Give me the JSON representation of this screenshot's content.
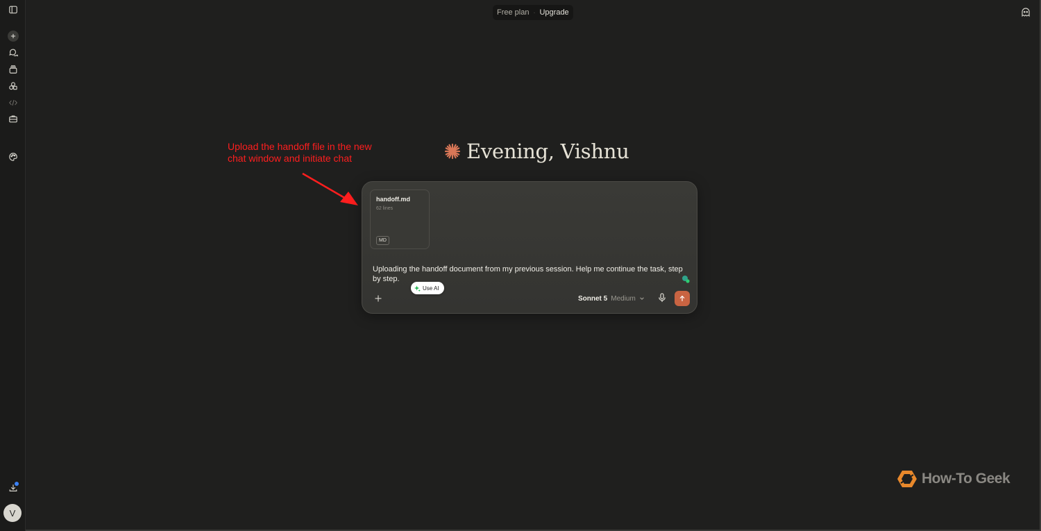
{
  "topbar": {
    "plan_label": "Free plan",
    "separator": "·",
    "upgrade_label": "Upgrade"
  },
  "greeting": {
    "text": "Evening, Vishnu"
  },
  "annotation": {
    "text": "Upload the handoff file in the new chat window and initiate chat",
    "color": "#ff1e1e"
  },
  "composer": {
    "attachment": {
      "filename": "handoff.md",
      "meta": "62 lines",
      "badge": "MD"
    },
    "prompt_text": "Uploading the handoff document from my previous session. Help me continue the task, step by step.",
    "use_ai_label": "Use AI",
    "model": {
      "name": "Sonnet 5",
      "effort": "Medium"
    }
  },
  "sidebar": {
    "avatar_initial": "V",
    "icons": [
      "sidebar-toggle-icon",
      "new-chat-icon",
      "chats-icon",
      "projects-icon",
      "artifacts-icon",
      "code-icon",
      "toolbox-icon",
      "palette-icon",
      "download-icon"
    ]
  },
  "watermark": {
    "text": "How-To Geek"
  },
  "colors": {
    "background": "#1f1f1e",
    "composer": "#3a3a36",
    "accent": "#c96442",
    "greeting_star": "#d97757"
  }
}
